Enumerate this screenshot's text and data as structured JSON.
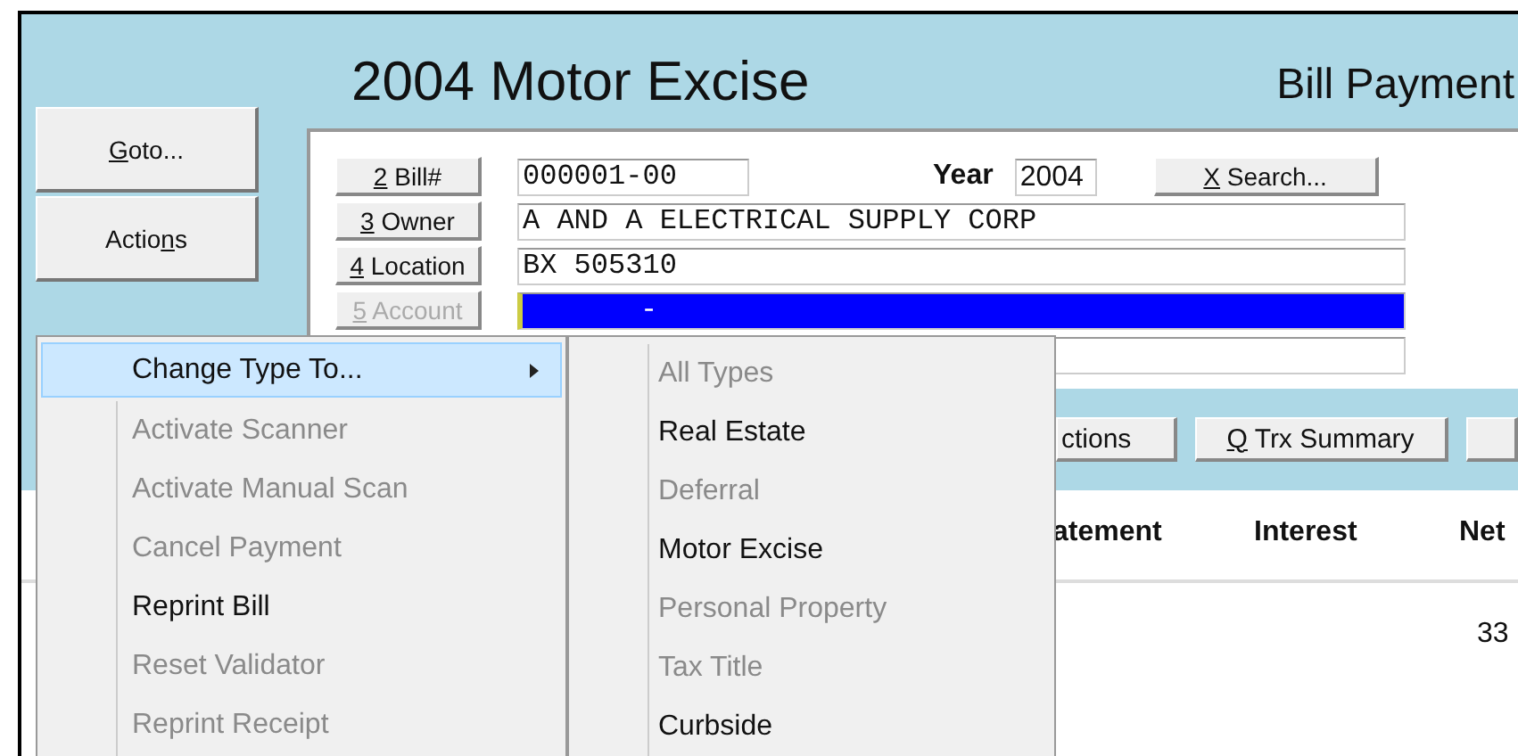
{
  "title": "2004 Motor Excise",
  "subtitle": "Bill Payment",
  "side_buttons": [
    {
      "key": "G",
      "post": "oto..."
    },
    {
      "pre": "Actio",
      "key": "n",
      "post": "s"
    }
  ],
  "fields": [
    {
      "label": {
        "key": "2",
        "post": " Bill#"
      },
      "disabled": false,
      "selected": false,
      "value": "000001-00",
      "kind": "bill"
    },
    {
      "label": {
        "key": "3",
        "post": " Owner"
      },
      "disabled": false,
      "selected": false,
      "value": "A AND A ELECTRICAL SUPPLY CORP",
      "kind": "text"
    },
    {
      "label": {
        "key": "4",
        "post": " Location"
      },
      "disabled": false,
      "selected": false,
      "value": "BX 505310",
      "kind": "text"
    },
    {
      "label": {
        "key": "5",
        "post": " Account"
      },
      "disabled": true,
      "selected": true,
      "value": "-",
      "kind": "text"
    }
  ],
  "year": {
    "label": "Year",
    "value": "2004"
  },
  "search": {
    "key": "X",
    "post": " Search..."
  },
  "toolbar": [
    {
      "pre": "ctions"
    },
    {
      "key": "Q",
      "post": " Trx Summary"
    }
  ],
  "columns": [
    "atement",
    "Interest",
    "Net"
  ],
  "rows": [
    {
      "net": "33"
    }
  ],
  "menu": [
    {
      "label": "Change Type To...",
      "disabled": false,
      "selected": true,
      "has_submenu": true
    },
    {
      "label": "Activate Scanner",
      "disabled": true,
      "selected": false,
      "has_submenu": false
    },
    {
      "label": "Activate Manual Scan",
      "disabled": true,
      "selected": false,
      "has_submenu": false
    },
    {
      "label": "Cancel Payment",
      "disabled": true,
      "selected": false,
      "has_submenu": false
    },
    {
      "label": "Reprint Bill",
      "disabled": false,
      "selected": false,
      "has_submenu": false
    },
    {
      "label": "Reset Validator",
      "disabled": true,
      "selected": false,
      "has_submenu": false
    },
    {
      "label": "Reprint Receipt",
      "disabled": true,
      "selected": false,
      "has_submenu": false
    }
  ],
  "submenu": [
    {
      "label": "All Types",
      "disabled": true
    },
    {
      "label": "Real Estate",
      "disabled": false
    },
    {
      "label": "Deferral",
      "disabled": true
    },
    {
      "label": "Motor Excise",
      "disabled": false
    },
    {
      "label": "Personal Property",
      "disabled": true
    },
    {
      "label": "Tax Title",
      "disabled": true
    },
    {
      "label": "Curbside",
      "disabled": false
    }
  ]
}
